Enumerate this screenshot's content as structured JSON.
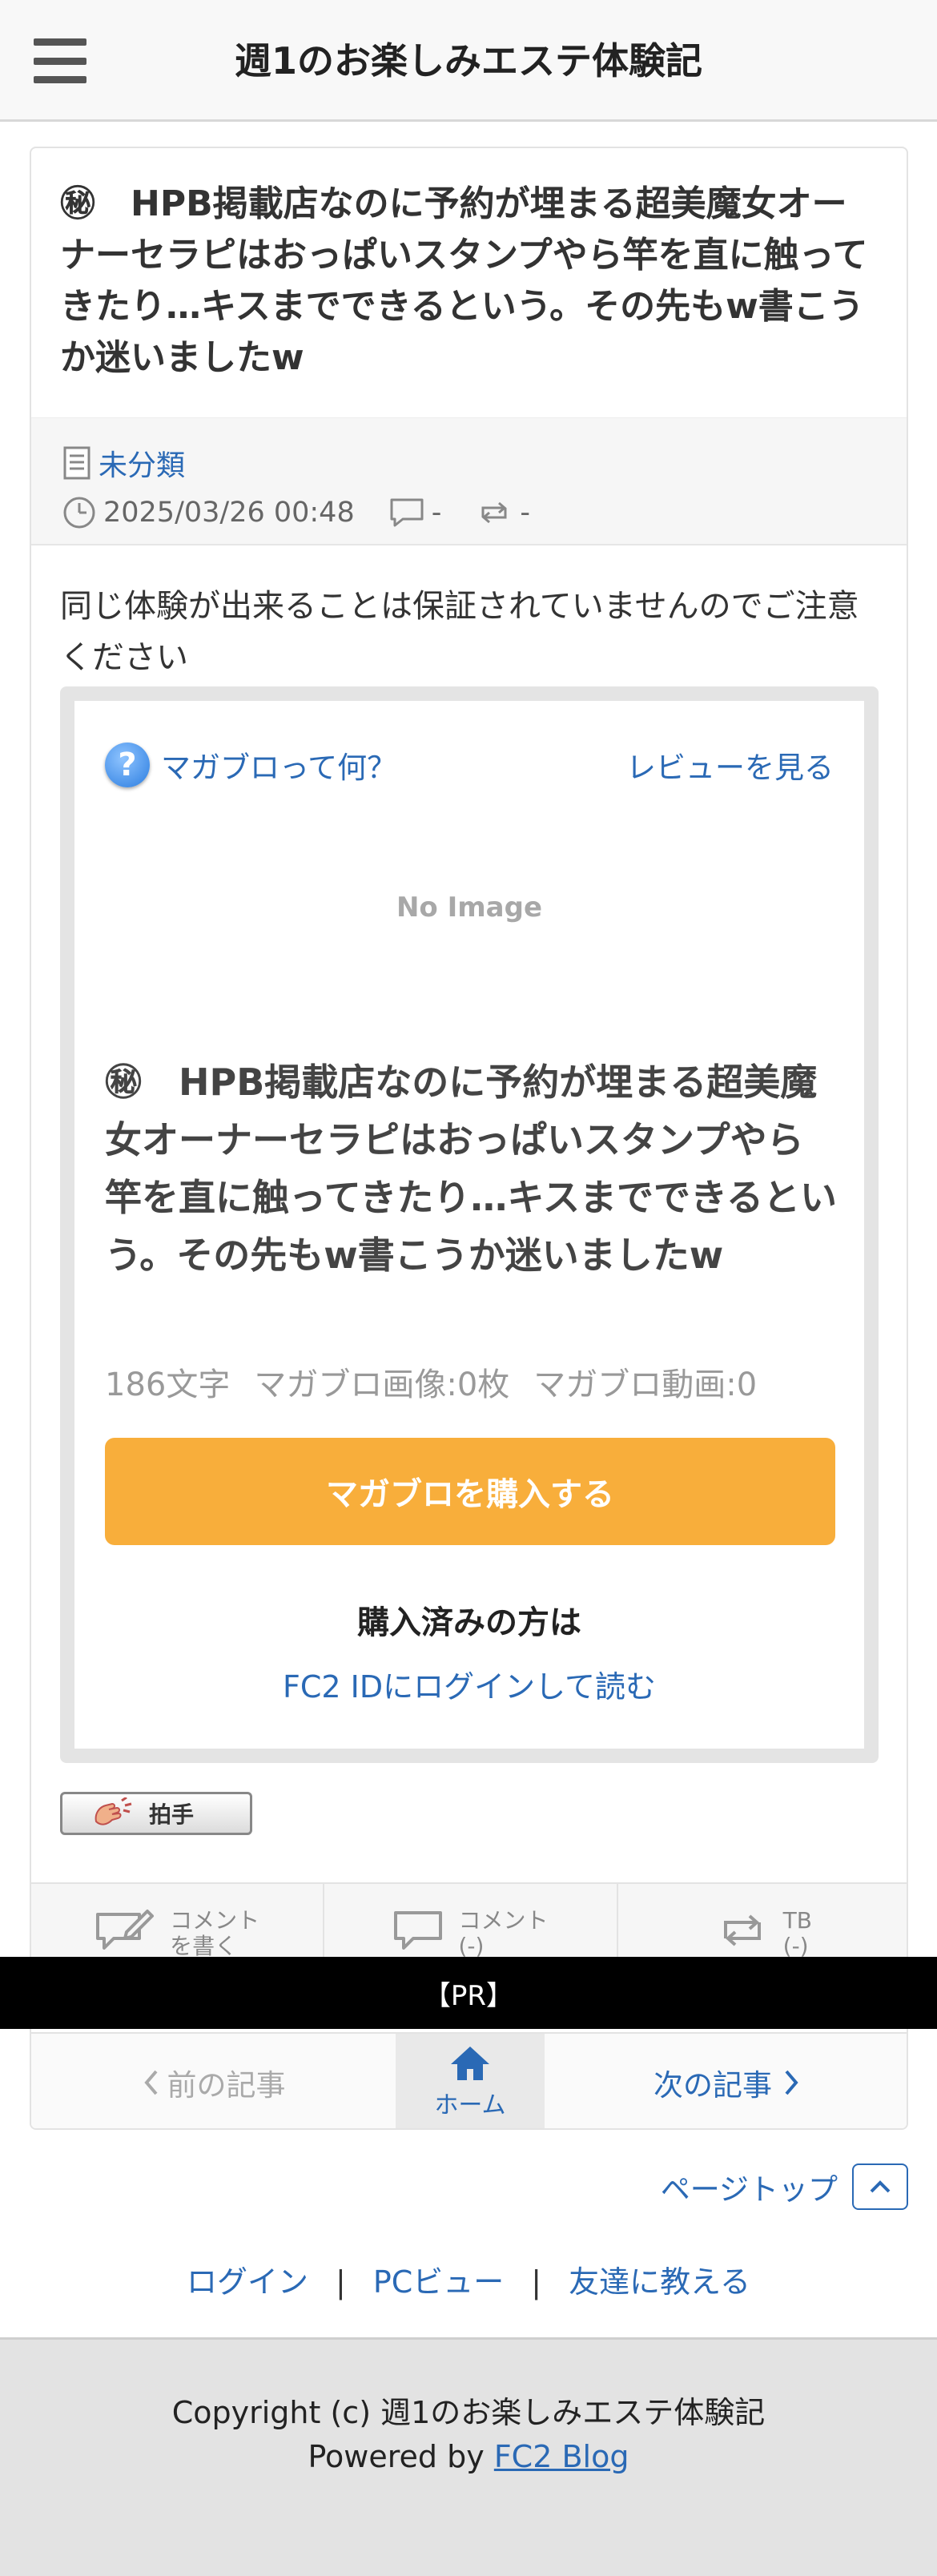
{
  "header": {
    "title": "週1のお楽しみエステ体験記",
    "menu_icon": "hamburger-menu-icon"
  },
  "article": {
    "title": "㊙　HPB掲載店なのに予約が埋まる超美魔女オーナーセラピはおっぱいスタンプやら竿を直に触ってきたり…キスまでできるという。その先もw書こうか迷いましたw",
    "category": "未分類",
    "datetime": "2025/03/26 00:48",
    "comment_count": "-",
    "trackback_count": "-",
    "intro": "同じ体験が出来ることは保証されていませんのでご注意ください"
  },
  "magablo": {
    "what_label": "マガブロって何？",
    "review_label": "レビューを見る",
    "no_image": "No Image",
    "title": "㊙　HPB掲載店なのに予約が埋まる超美魔女オーナーセラピはおっぱいスタンプやら竿を直に触ってきたり…キスまでできるという。その先もw書こうか迷いましたw",
    "char_count": "186文字",
    "image_count": "マガブロ画像:0枚",
    "video_count": "マガブロ動画:0",
    "buy_label": "マガブロを購入する",
    "bought_label": "購入済みの方は",
    "login_label": "FC2 IDにログインして読む"
  },
  "clap": {
    "label": "拍手"
  },
  "actions": {
    "write_comment_1": "コメント",
    "write_comment_2": "を書く",
    "comment_1": "コメント",
    "comment_2": "(-)",
    "tb_1": "TB",
    "tb_2": "(-)"
  },
  "pr": {
    "label": "【PR】"
  },
  "pager": {
    "prev": "前の記事",
    "home": "ホーム",
    "next": "次の記事"
  },
  "page_top": "ページトップ",
  "footer_links": {
    "login": "ログイン",
    "pc_view": "PCビュー",
    "tell_friend": "友達に教える",
    "separator": "|"
  },
  "footer": {
    "copyright": "Copyright (c) 週1のお楽しみエステ体験記",
    "powered_prefix": "Powered by ",
    "powered_link": "FC2 Blog"
  },
  "colors": {
    "accent": "#2a69b5",
    "buy_button": "#f8ae3b",
    "pr_bar": "#000000",
    "footer_bg": "#e3e3e3"
  }
}
